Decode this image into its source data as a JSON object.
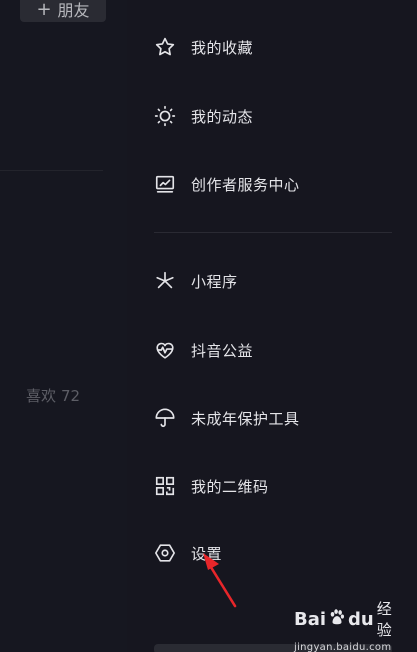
{
  "background": {
    "add_friend_label": "朋友",
    "add_friend_plus": "+",
    "likes_label": "喜欢",
    "likes_count": "72"
  },
  "drawer": {
    "items": [
      {
        "label": "我的收藏",
        "icon": "star-icon"
      },
      {
        "label": "我的动态",
        "icon": "sun-icon"
      },
      {
        "label": "创作者服务中心",
        "icon": "chart-monitor-icon"
      },
      {
        "label": "小程序",
        "icon": "asterisk-icon"
      },
      {
        "label": "抖音公益",
        "icon": "heart-pulse-icon"
      },
      {
        "label": "未成年保护工具",
        "icon": "umbrella-icon"
      },
      {
        "label": "我的二维码",
        "icon": "qr-code-icon"
      },
      {
        "label": "设置",
        "icon": "hexagon-gear-icon"
      }
    ]
  },
  "annotation": {
    "color": "#e8262a"
  },
  "watermark": {
    "brand_bai": "Bai",
    "brand_du": "du",
    "brand_jingyan": "经验",
    "url": "jingyan.baidu.com"
  }
}
